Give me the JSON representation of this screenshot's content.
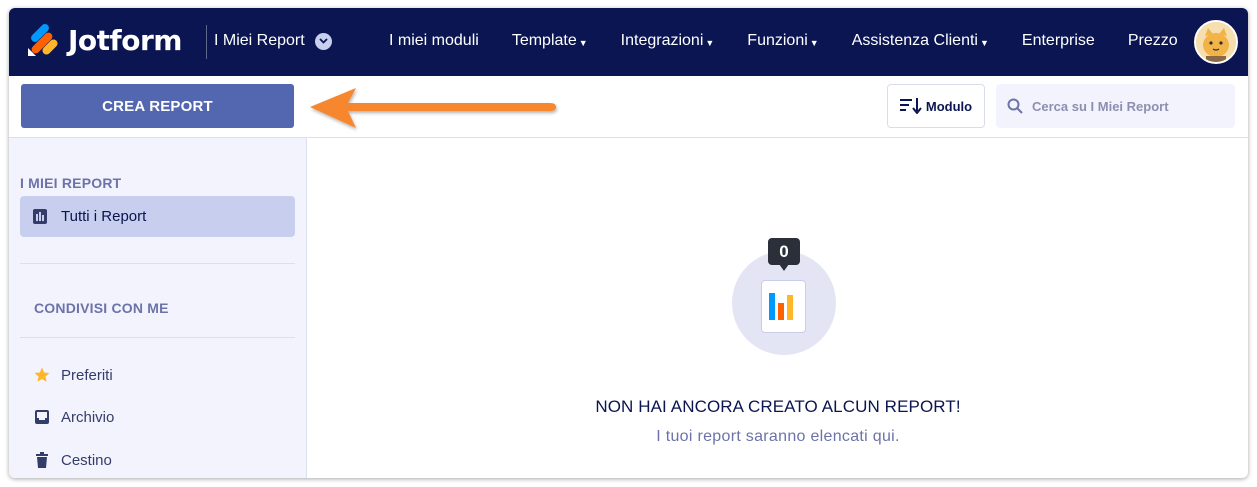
{
  "app": {
    "brand": "Jotform",
    "section_title": "I Miei Report"
  },
  "nav": {
    "items": [
      {
        "label": "I miei moduli",
        "dropdown": false
      },
      {
        "label": "Template",
        "dropdown": true
      },
      {
        "label": "Integrazioni",
        "dropdown": true
      },
      {
        "label": "Funzioni",
        "dropdown": true
      },
      {
        "label": "Assistenza Clienti",
        "dropdown": true
      },
      {
        "label": "Enterprise",
        "dropdown": false
      },
      {
        "label": "Prezzo",
        "dropdown": false
      }
    ],
    "avatar_icon": "cat-avatar"
  },
  "sidebar": {
    "create_button": "CREA REPORT",
    "my_reports_title": "I MIEI REPORT",
    "all_reports_label": "Tutti i Report",
    "shared_title": "CONDIVISI CON ME",
    "items": [
      {
        "label": "Preferiti",
        "icon": "star-icon"
      },
      {
        "label": "Archivio",
        "icon": "archive-icon"
      },
      {
        "label": "Cestino",
        "icon": "trash-icon"
      }
    ]
  },
  "toolbar": {
    "sort_label": "Modulo",
    "search_placeholder": "Cerca su I Miei Report"
  },
  "empty_state": {
    "count": "0",
    "title": "NON HAI ANCORA CREATO ALCUN REPORT!",
    "subtitle": "I tuoi report saranno elencati qui."
  },
  "colors": {
    "nav_bg": "#0a1551",
    "button_bg": "#5367b0",
    "sidebar_bg": "#f3f3fe",
    "active_item_bg": "#c8ceed",
    "arrow": "#f7872f"
  }
}
